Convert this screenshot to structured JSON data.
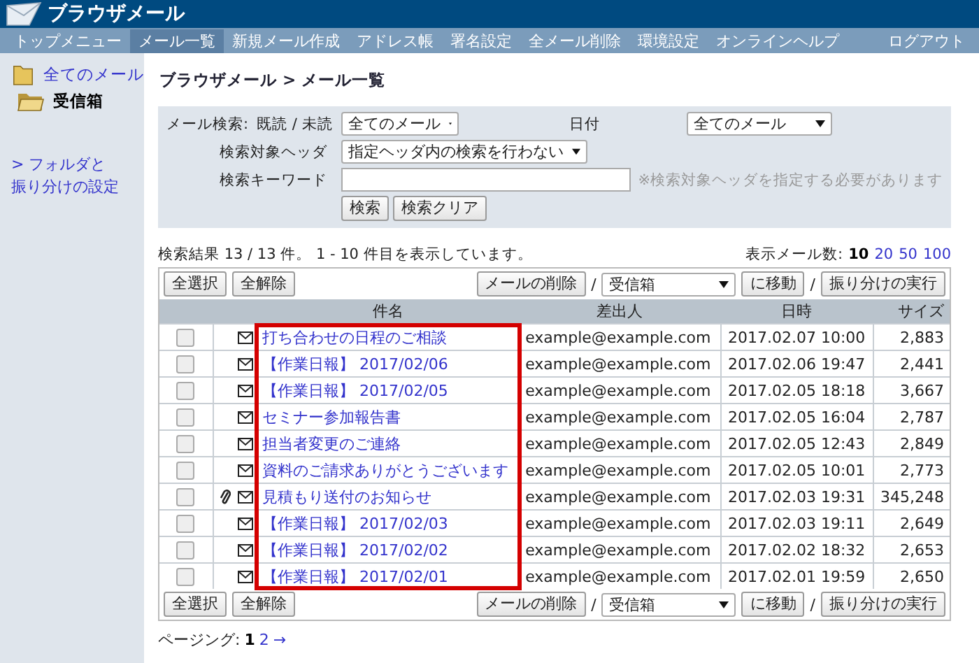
{
  "app": {
    "title": "ブラウザメール"
  },
  "nav": [
    {
      "label": "トップメニュー",
      "selected": false
    },
    {
      "label": "メール一覧",
      "selected": true
    },
    {
      "label": "新規メール作成",
      "selected": false
    },
    {
      "label": "アドレス帳",
      "selected": false
    },
    {
      "label": "署名設定",
      "selected": false
    },
    {
      "label": "全メール削除",
      "selected": false
    },
    {
      "label": "環境設定",
      "selected": false
    },
    {
      "label": "オンラインヘルプ",
      "selected": false
    }
  ],
  "logout": "ログアウト",
  "sidebar": {
    "folders": [
      {
        "label": "全てのメール",
        "selected": false
      },
      {
        "label": "受信箱",
        "selected": true
      }
    ],
    "settings_link": [
      "> フォルダと",
      "振り分けの設定"
    ]
  },
  "breadcrumb": "ブラウザメール > メール一覧",
  "search": {
    "label": "メール検索:",
    "read_label": "既読 / 未読",
    "read_value": "全てのメール",
    "date_label": "日付",
    "date_value": "全てのメール",
    "header_label": "検索対象ヘッダ",
    "header_value": "指定ヘッダ内の検索を行わない",
    "keyword_label": "検索キーワード",
    "keyword_note": "※検索対象ヘッダを指定する必要があります",
    "buttons": [
      "検索",
      "検索クリア"
    ]
  },
  "result_summary": "検索結果 13 / 13 件。 1 - 10 件目を表示しています。",
  "page_size": {
    "label": "表示メール数:",
    "options": [
      {
        "label": "10",
        "selected": true
      },
      {
        "label": "20",
        "selected": false
      },
      {
        "label": "50",
        "selected": false
      },
      {
        "label": "100",
        "selected": false
      }
    ]
  },
  "toolbars": [
    {
      "select_all": "全選択",
      "deselect_all": "全解除",
      "delete": "メールの削除",
      "separator_1": "/",
      "folder": "受信箱",
      "move": "に移動",
      "separator_2": "/",
      "filter": "振り分けの実行"
    },
    {
      "select_all": "全選択",
      "deselect_all": "全解除",
      "delete": "メールの削除",
      "separator_1": "/",
      "folder": "受信箱",
      "move": "に移動",
      "separator_2": "/",
      "filter": "振り分けの実行"
    }
  ],
  "table": {
    "columns": [
      "件名",
      "差出人",
      "日時",
      "サイズ"
    ],
    "rows": [
      {
        "checked": false,
        "attachment": false,
        "subject": "打ち合わせの日程のご相談",
        "from": "example@example.com",
        "date": "2017.02.07 10:00",
        "size": "2,883"
      },
      {
        "checked": false,
        "attachment": false,
        "subject": "【作業日報】 2017/02/06",
        "from": "example@example.com",
        "date": "2017.02.06 19:47",
        "size": "2,441"
      },
      {
        "checked": false,
        "attachment": false,
        "subject": "【作業日報】 2017/02/05",
        "from": "example@example.com",
        "date": "2017.02.05 18:18",
        "size": "3,667"
      },
      {
        "checked": false,
        "attachment": false,
        "subject": "セミナー参加報告書",
        "from": "example@example.com",
        "date": "2017.02.05 16:04",
        "size": "2,787"
      },
      {
        "checked": false,
        "attachment": false,
        "subject": "担当者変更のご連絡",
        "from": "example@example.com",
        "date": "2017.02.05 12:43",
        "size": "2,849"
      },
      {
        "checked": false,
        "attachment": false,
        "subject": "資料のご請求ありがとうございます",
        "from": "example@example.com",
        "date": "2017.02.05 10:01",
        "size": "2,773"
      },
      {
        "checked": false,
        "attachment": true,
        "subject": "見積もり送付のお知らせ",
        "from": "example@example.com",
        "date": "2017.02.03 19:31",
        "size": "345,248"
      },
      {
        "checked": false,
        "attachment": false,
        "subject": "【作業日報】 2017/02/03",
        "from": "example@example.com",
        "date": "2017.02.03 19:11",
        "size": "2,649"
      },
      {
        "checked": false,
        "attachment": false,
        "subject": "【作業日報】 2017/02/02",
        "from": "example@example.com",
        "date": "2017.02.02 18:32",
        "size": "2,653"
      },
      {
        "checked": false,
        "attachment": false,
        "subject": "【作業日報】 2017/02/01",
        "from": "example@example.com",
        "date": "2017.02.01 19:59",
        "size": "2,650"
      }
    ]
  },
  "highlight": {
    "kind": "frame"
  },
  "paging": {
    "label": "ページング:",
    "pages": [
      {
        "label": "1",
        "selected": true
      },
      {
        "label": "2",
        "selected": false
      }
    ],
    "next": "→"
  }
}
